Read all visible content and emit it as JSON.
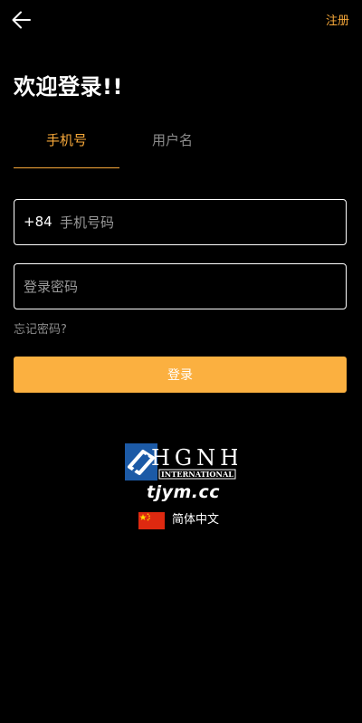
{
  "header": {
    "back_icon": "arrow-left-icon",
    "register_label": "注册"
  },
  "title": "欢迎登录!!",
  "tabs": [
    {
      "label": "手机号",
      "active": true
    },
    {
      "label": "用户名",
      "active": false
    }
  ],
  "phone_field": {
    "country_code": "+84",
    "placeholder": "手机号码",
    "value": ""
  },
  "password_field": {
    "placeholder": "登录密码",
    "value": ""
  },
  "forgot_password_label": "忘记密码?",
  "login_button_label": "登录",
  "brand": {
    "logo_text": "HGNH",
    "logo_subtext": "INTERNATIONAL",
    "url": "tjym.cc"
  },
  "language": {
    "flag_icon": "china-flag-icon",
    "label": "简体中文"
  },
  "colors": {
    "background": "#000000",
    "accent": "#f8a93a",
    "button": "#fbb040",
    "muted_text": "#8c8c8c"
  }
}
